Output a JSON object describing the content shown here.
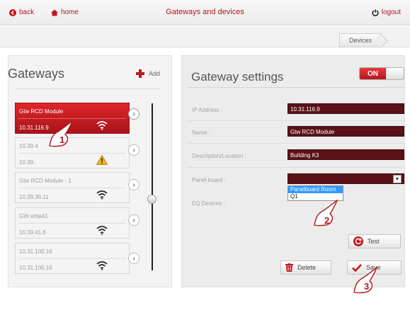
{
  "topbar": {
    "back_label": "back",
    "home_label": "home",
    "title": "Gateways and devices",
    "logout_label": "logout"
  },
  "breadcrumb": {
    "current": "Devices"
  },
  "gateways": {
    "title": "Gateways",
    "add_label": "Add",
    "items": [
      {
        "line1": "Gtw RCD Module",
        "line2": "10.31.116.9",
        "status": "wifi-icon",
        "active": true
      },
      {
        "line1": "10.39.4",
        "line2": "10.39.",
        "status": "warning-icon",
        "active": false
      },
      {
        "line1": "Gtw RCD Module - 1",
        "line2": "10.39.36.11",
        "status": "wifi-icon",
        "active": false
      },
      {
        "line1": "GW erba41",
        "line2": "10.39.41.6",
        "status": "wifi-icon",
        "active": false
      },
      {
        "line1": "10.31.100.16",
        "line2": "10.31.100.16",
        "status": "wifi-icon",
        "active": false
      }
    ]
  },
  "settings": {
    "title": "Gateway settings",
    "toggle_label": "ON",
    "ip_label": "IP Address :",
    "ip_value": "10.31.116.9",
    "name_label": "Name :",
    "name_value": "Gtw RCD Module",
    "desc_label": "Description/Location :",
    "desc_value": "Building K3",
    "panel_label": "Panel board :",
    "eq_label": "EQ Devices :",
    "panel_options": [
      "Panelboard Room",
      "Q1"
    ],
    "test_label": "Test",
    "delete_label": "Delete",
    "save_label": "Save"
  },
  "callouts": [
    "1",
    "2",
    "3"
  ],
  "colors": {
    "accent": "#b3161c",
    "field_bg": "#5a1216",
    "selected_option": "#3399ff"
  }
}
